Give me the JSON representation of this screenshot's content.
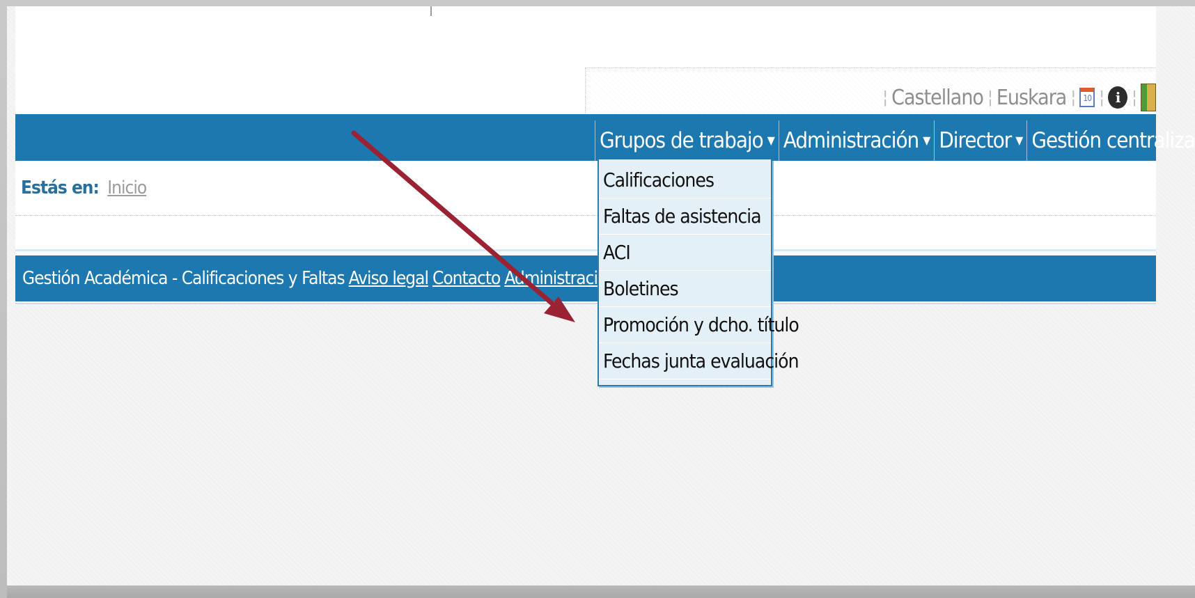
{
  "lang_bar": {
    "castellano": "Castellano",
    "euskara": "Euskara",
    "icons": [
      "calendar-icon",
      "info-icon",
      "exit-icon"
    ]
  },
  "nav": {
    "items": [
      {
        "label": "Grupos de trabajo"
      },
      {
        "label": "Administración"
      },
      {
        "label": "Director"
      },
      {
        "label": "Gestión centralizada"
      }
    ]
  },
  "breadcrumb": {
    "label": "Estás en:",
    "link": "Inicio"
  },
  "dropdown": {
    "items": [
      "Calificaciones",
      "Faltas de asistencia",
      "ACI",
      "Boletines",
      "Promoción y dcho. título",
      "Fechas junta evaluación"
    ]
  },
  "footer": {
    "text": "Gestión Académica - Calificaciones y Faltas",
    "links": [
      "Aviso legal",
      "Contacto",
      "Administración"
    ]
  },
  "colors": {
    "nav_blue": "#1e78b0",
    "annotation_arrow": "#9b2233",
    "dropdown_bg": "#e4f0f7"
  }
}
